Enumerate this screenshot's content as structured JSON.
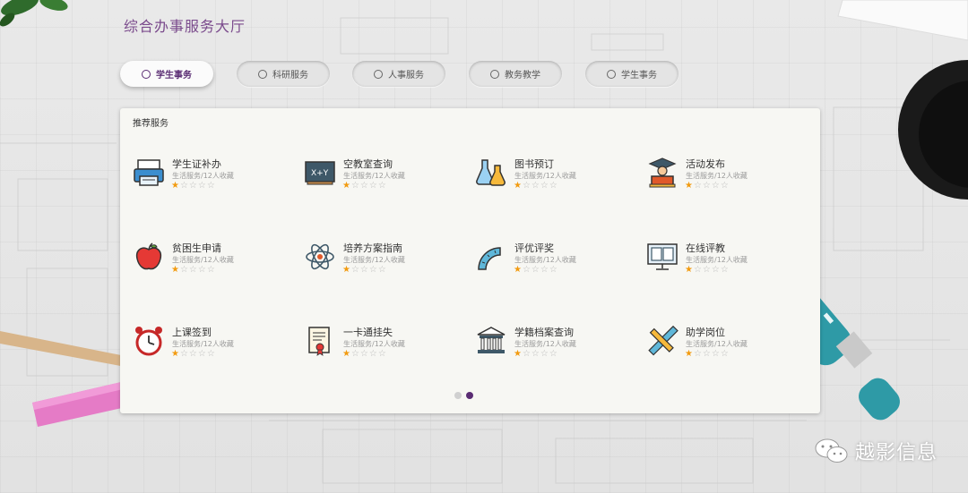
{
  "page": {
    "title": "综合办事服务大厅"
  },
  "tabs": [
    {
      "label": "学生事务",
      "active": true
    },
    {
      "label": "科研服务",
      "active": false
    },
    {
      "label": "人事服务",
      "active": false
    },
    {
      "label": "教务教学",
      "active": false
    },
    {
      "label": "学生事务",
      "active": false
    }
  ],
  "panel": {
    "title": "推荐服务"
  },
  "services": [
    {
      "name": "学生证补办",
      "sub": "生活服务/12人收藏",
      "rating": 1,
      "icon": "printer-icon"
    },
    {
      "name": "空教室查询",
      "sub": "生活服务/12人收藏",
      "rating": 1,
      "icon": "blackboard-icon"
    },
    {
      "name": "图书预订",
      "sub": "生活服务/12人收藏",
      "rating": 1,
      "icon": "flask-icon"
    },
    {
      "name": "活动发布",
      "sub": "生活服务/12人收藏",
      "rating": 1,
      "icon": "graduate-icon"
    },
    {
      "name": "贫困生申请",
      "sub": "生活服务/12人收藏",
      "rating": 1,
      "icon": "apple-icon"
    },
    {
      "name": "培养方案指南",
      "sub": "生活服务/12人收藏",
      "rating": 1,
      "icon": "atom-icon"
    },
    {
      "name": "评优评奖",
      "sub": "生活服务/12人收藏",
      "rating": 1,
      "icon": "protractor-icon"
    },
    {
      "name": "在线评教",
      "sub": "生活服务/12人收藏",
      "rating": 1,
      "icon": "monitor-book-icon"
    },
    {
      "name": "上课签到",
      "sub": "生活服务/12人收藏",
      "rating": 1,
      "icon": "alarm-clock-icon"
    },
    {
      "name": "一卡通挂失",
      "sub": "生活服务/12人收藏",
      "rating": 1,
      "icon": "certificate-icon"
    },
    {
      "name": "学籍档案查询",
      "sub": "生活服务/12人收藏",
      "rating": 1,
      "icon": "bank-building-icon"
    },
    {
      "name": "助学岗位",
      "sub": "生活服务/12人收藏",
      "rating": 1,
      "icon": "ruler-pencil-icon"
    }
  ],
  "pagination": {
    "current": 2,
    "total": 2
  },
  "watermark": {
    "text": "越影信息"
  },
  "colors": {
    "accent": "#5a2c73",
    "title": "#7a4a8c",
    "star": "#f29b10",
    "dot_inactive": "#d0d0d0"
  }
}
